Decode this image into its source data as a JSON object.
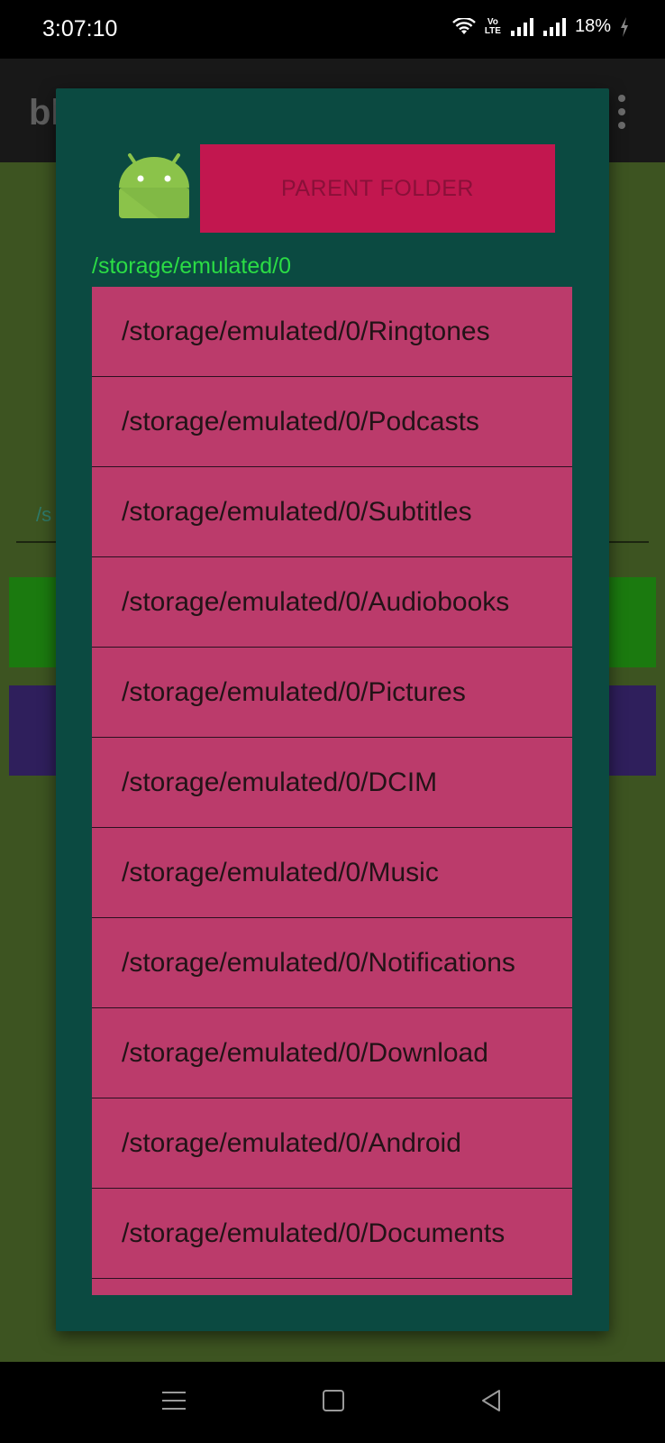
{
  "status_bar": {
    "time": "3:07:10",
    "battery": "18%",
    "volte_line1": "Vo",
    "volte_line2": "LTE"
  },
  "app": {
    "title_partial": "bl",
    "path_partial": "/s"
  },
  "dialog": {
    "parent_button_label": "PARENT FOLDER",
    "current_path": "/storage/emulated/0",
    "folders": [
      "/storage/emulated/0/Ringtones",
      "/storage/emulated/0/Podcasts",
      "/storage/emulated/0/Subtitles",
      "/storage/emulated/0/Audiobooks",
      "/storage/emulated/0/Pictures",
      "/storage/emulated/0/DCIM",
      "/storage/emulated/0/Music",
      "/storage/emulated/0/Notifications",
      "/storage/emulated/0/Download",
      "/storage/emulated/0/Android",
      "/storage/emulated/0/Documents",
      ""
    ]
  },
  "colors": {
    "dialog_bg": "#0b4a41",
    "parent_button_bg": "#c2174f",
    "list_item_bg": "#bb3b6b",
    "path_text": "#2bdc45"
  }
}
